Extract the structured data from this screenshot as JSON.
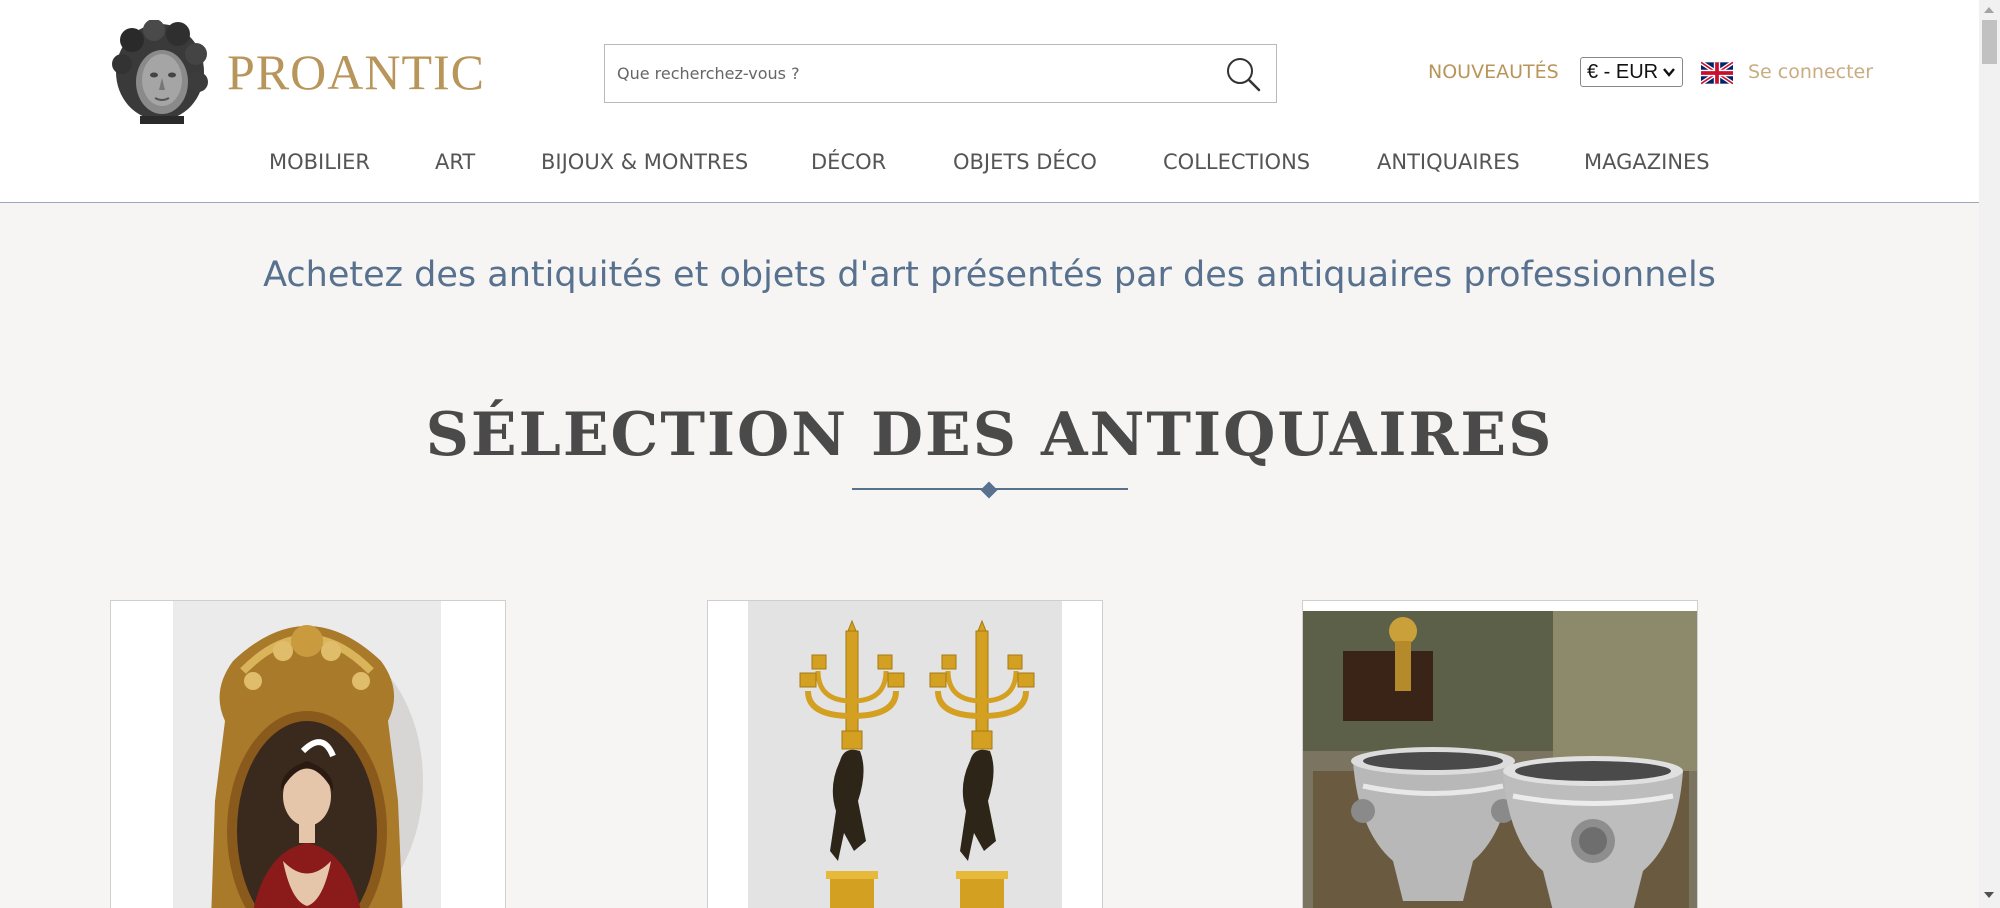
{
  "brand": {
    "name": "PROANTIC"
  },
  "search": {
    "placeholder": "Que recherchez-vous ?",
    "value": ""
  },
  "header_links": {
    "new_label": "NOUVEAUTÉS",
    "currency_value": "€ - EUR",
    "login_label": "Se connecter"
  },
  "nav": {
    "items": [
      {
        "label": "MOBILIER"
      },
      {
        "label": "ART"
      },
      {
        "label": "BIJOUX & MONTRES"
      },
      {
        "label": "DÉCOR"
      },
      {
        "label": "OBJETS DÉCO"
      },
      {
        "label": "COLLECTIONS"
      },
      {
        "label": "ANTIQUAIRES"
      },
      {
        "label": "MAGAZINES"
      }
    ]
  },
  "hero": {
    "tagline": "Achetez des antiquités et objets d'art présentés par des antiquaires professionnels"
  },
  "selection": {
    "title": "SÉLECTION DES ANTIQUAIRES",
    "cards": [
      {
        "image": "gilded-frame-portrait"
      },
      {
        "image": "pair-of-candelabra"
      },
      {
        "image": "silver-wine-coolers"
      }
    ]
  },
  "colors": {
    "brand_gold": "#b8955a",
    "link_light_gold": "#c9ad80",
    "accent_blue": "#57718e",
    "page_bg": "#f6f5f4"
  },
  "icons": {
    "logo": "sculpted-head-logo",
    "search": "magnifier-icon",
    "flag": "uk-flag-icon"
  }
}
